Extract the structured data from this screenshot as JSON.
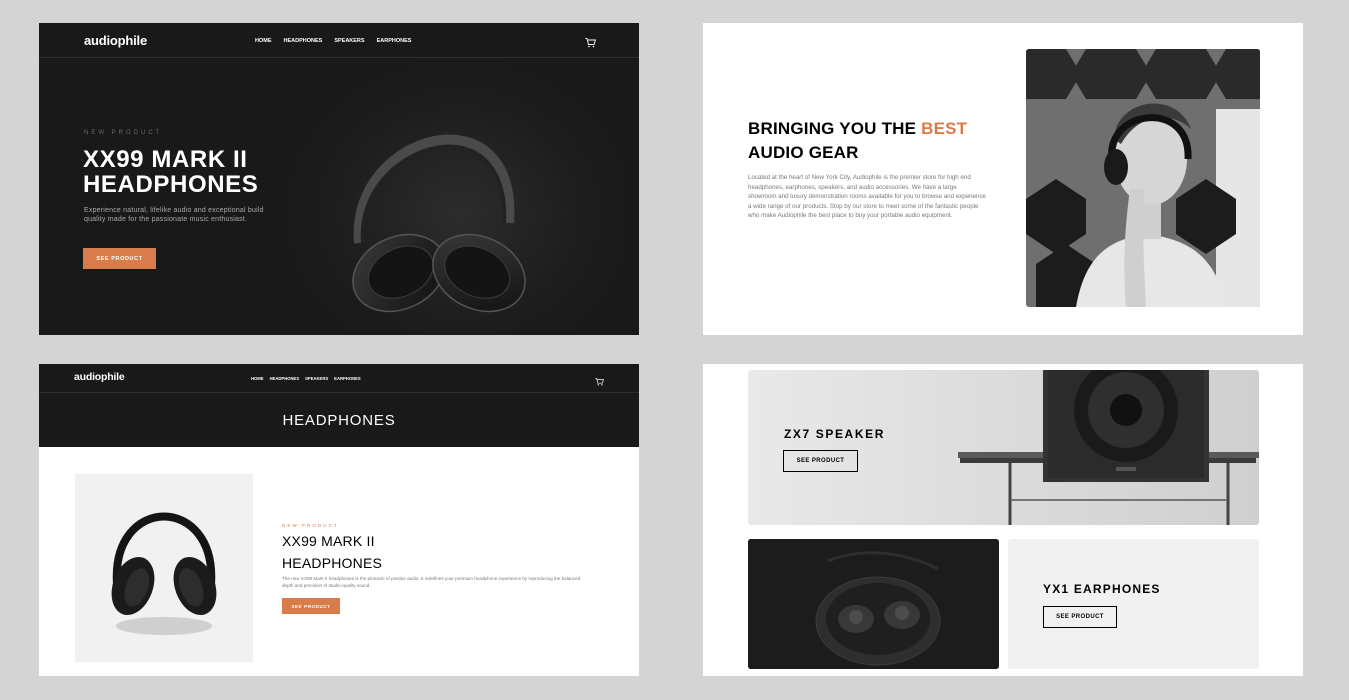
{
  "hero_screen": {
    "logo": "audiophile",
    "nav": [
      "HOME",
      "HEADPHONES",
      "SPEAKERS",
      "EARPHONES"
    ],
    "cart_icon": "cart-icon",
    "eyebrow": "NEW PRODUCT",
    "title": "XX99 MARK II HEADPHONES",
    "description": "Experience natural, lifelike audio and exceptional build quality made for the passionate music enthusiast.",
    "cta": "SEE PRODUCT"
  },
  "about_screen": {
    "title_pre": "BRINGING YOU THE ",
    "title_accent": "BEST",
    "title_post": "AUDIO GEAR",
    "text": "Located at the heart of New York City, Audiophile is the premier store for high end headphones, earphones, speakers, and audio accessories. We have a large showroom and luxury demonstration rooms available for you to browse and experience a wide range of our products. Stop by our store to meet some of the fantastic people who make Audiophile the best place to buy your portable audio equipment."
  },
  "category_screen": {
    "logo": "audiophile",
    "nav": [
      "HOME",
      "HEADPHONES",
      "SPEAKERS",
      "EARPHONES"
    ],
    "cart_icon": "cart-icon",
    "category_title": "HEADPHONES",
    "eyebrow": "NEW PRODUCT",
    "product_title": "XX99 MARK II HEADPHONES",
    "product_description": "The new XX99 Mark II headphones is the pinnacle of pristine audio. It redefines your premium headphone experience by reproducing the balanced depth and precision of studio-quality sound.",
    "cta": "SEE PRODUCT"
  },
  "products_screen": {
    "zx7_title": "ZX7 SPEAKER",
    "zx7_cta": "SEE PRODUCT",
    "yx1_title": "YX1 EARPHONES",
    "yx1_cta": "SEE PRODUCT"
  },
  "colors": {
    "accent": "#d87d4a",
    "dark": "#191919",
    "light_gray": "#f1f1f1",
    "background": "#d4d4d4"
  }
}
